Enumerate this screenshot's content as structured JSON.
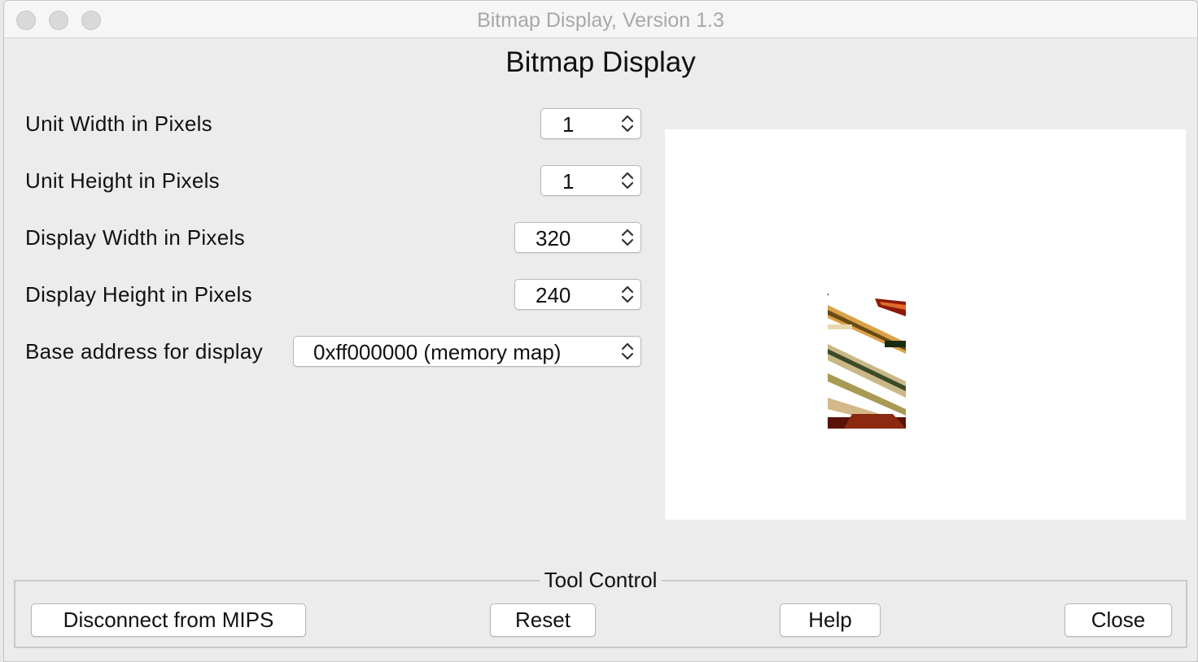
{
  "window": {
    "title": "Bitmap Display, Version 1.3"
  },
  "heading": "Bitmap Display",
  "settings": [
    {
      "label": "Unit Width in Pixels",
      "value": "1"
    },
    {
      "label": "Unit Height in Pixels",
      "value": "1"
    },
    {
      "label": "Display Width in Pixels",
      "value": "320"
    },
    {
      "label": "Display Height in Pixels",
      "value": "240"
    },
    {
      "label": "Base address for display",
      "value": "0xff000000 (memory map)"
    }
  ],
  "tool_control": {
    "title": "Tool Control",
    "buttons": {
      "disconnect": "Disconnect from MIPS",
      "reset": "Reset",
      "help": "Help",
      "close": "Close"
    }
  },
  "icons": {
    "spinner_arrows": "chevron-up-down-icon",
    "traffic_lights": [
      "close-icon",
      "minimize-icon",
      "zoom-icon"
    ]
  },
  "colors": {
    "window_bg": "#ececec",
    "preview_bg": "#ffffff",
    "title_text": "#a8a8a8"
  }
}
